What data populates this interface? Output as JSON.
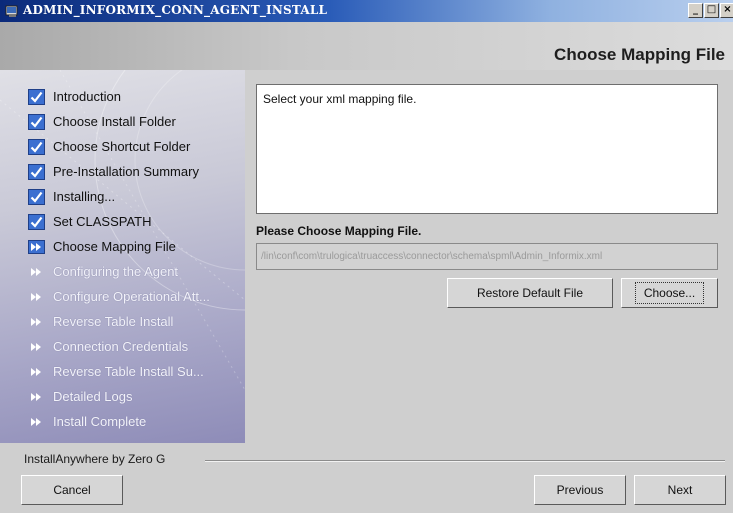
{
  "window": {
    "title": "ADMIN_INFORMIX_CONN_AGENT_INSTALL",
    "controls": {
      "minimize": "_",
      "maximize": "□",
      "close": "×"
    }
  },
  "header": {
    "page_title": "Choose Mapping File"
  },
  "sidebar": {
    "steps": [
      {
        "label": "Introduction",
        "state": "done"
      },
      {
        "label": "Choose Install Folder",
        "state": "done"
      },
      {
        "label": "Choose Shortcut Folder",
        "state": "done"
      },
      {
        "label": "Pre-Installation Summary",
        "state": "done"
      },
      {
        "label": "Installing...",
        "state": "done"
      },
      {
        "label": "Set CLASSPATH",
        "state": "done"
      },
      {
        "label": "Choose Mapping File",
        "state": "current"
      },
      {
        "label": "Configuring the Agent",
        "state": "pending"
      },
      {
        "label": "Configure Operational Att...",
        "state": "pending"
      },
      {
        "label": "Reverse Table Install",
        "state": "pending"
      },
      {
        "label": "Connection Credentials",
        "state": "pending"
      },
      {
        "label": "Reverse Table Install Su...",
        "state": "pending"
      },
      {
        "label": "Detailed Logs",
        "state": "pending"
      },
      {
        "label": "Install Complete",
        "state": "pending"
      }
    ]
  },
  "main": {
    "message": "Select your xml mapping file.",
    "choose_label": "Please Choose Mapping File.",
    "path_value": "/lin\\conf\\com\\trulogica\\truaccess\\connector\\schema\\spml\\Admin_Informix.xml",
    "restore_button": "Restore Default File",
    "choose_button": "Choose..."
  },
  "footer": {
    "brand": "InstallAnywhere by Zero G",
    "cancel_button": "Cancel",
    "previous_button": "Previous",
    "next_button": "Next"
  },
  "colors": {
    "check_blue": "#3b6fd0",
    "title_bar_start": "#0b2a7a",
    "title_bar_end": "#b9cfee"
  }
}
